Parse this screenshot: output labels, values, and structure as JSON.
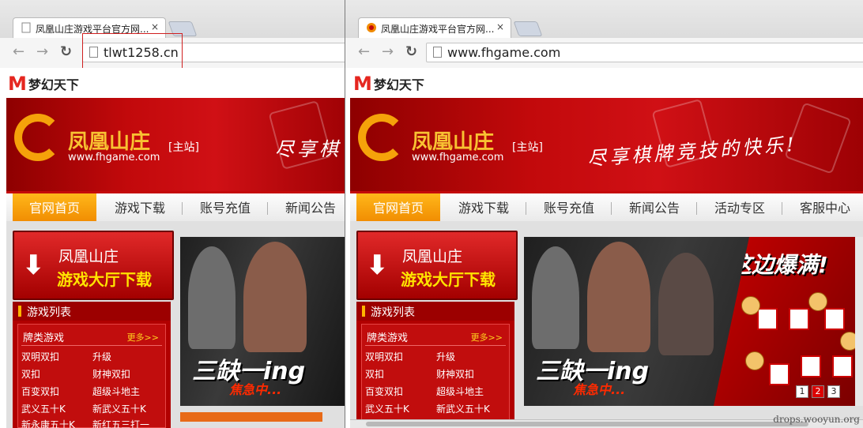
{
  "left_window": {
    "tab_title": "凤凰山庄游戏平台官方网...",
    "tab_close": "×",
    "url": "tlwt1258.cn",
    "brand": {
      "mark": "M",
      "name": "梦幻天下"
    },
    "logo": {
      "name": "凤凰山庄",
      "tag": "[主站]",
      "url": "www.fhgame.com"
    },
    "slogan": "尽享棋",
    "nav": [
      "官网首页",
      "游戏下载",
      "账号充值",
      "新闻公告"
    ],
    "download": {
      "line1": "凤凰山庄",
      "line2": "游戏大厅下载"
    },
    "game_list": {
      "title": "游戏列表",
      "category": "牌类游戏",
      "more": "更多>>",
      "games": [
        "双明双扣",
        "升级",
        "双扣",
        "财神双扣",
        "百变双扣",
        "超级斗地主",
        "武义五十K",
        "新武义五十K",
        "新永康五十K",
        "新红五三打一"
      ]
    },
    "promo": {
      "big": "三缺一ing",
      "sub": "焦急中..."
    }
  },
  "right_window": {
    "tab_title": "凤凰山庄游戏平台官方网...",
    "tab_close": "×",
    "url": "www.fhgame.com",
    "brand": {
      "mark": "M",
      "name": "梦幻天下"
    },
    "logo": {
      "name": "凤凰山庄",
      "tag": "[主站]",
      "url": "www.fhgame.com"
    },
    "slogan": "尽享棋牌竞技的快乐!",
    "nav": [
      "官网首页",
      "游戏下载",
      "账号充值",
      "新闻公告",
      "活动专区",
      "客服中心"
    ],
    "download": {
      "line1": "凤凰山庄",
      "line2": "游戏大厅下载"
    },
    "game_list": {
      "title": "游戏列表",
      "category": "牌类游戏",
      "more": "更多>>",
      "games": [
        "双明双扣",
        "升级",
        "双扣",
        "财神双扣",
        "百变双扣",
        "超级斗地主",
        "武义五十K",
        "新武义五十K"
      ]
    },
    "promo": {
      "big": "三缺一ing",
      "sub": "焦急中...",
      "headline": "这边爆满!",
      "pages": [
        "1",
        "2",
        "3"
      ]
    }
  },
  "watermark": "drops.wooyun.org",
  "colors": {
    "brand_red": "#c40a0a",
    "nav_active": "#f08a00",
    "logo_gold": "#f8c232",
    "highlight_box": "#d02020"
  }
}
